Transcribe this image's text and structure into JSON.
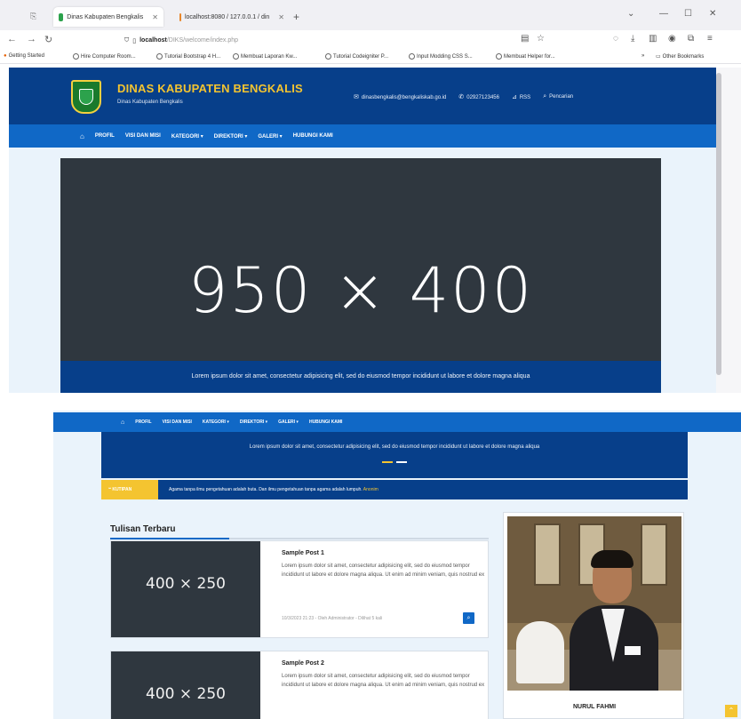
{
  "browser": {
    "tabs": [
      {
        "label": "Dinas Kabupaten Bengkalis",
        "active": true
      },
      {
        "label": "localhost:8080 / 127.0.0.1 / din",
        "active": false
      }
    ],
    "new_tab": "+",
    "url": "localhost",
    "url_path": "/DIKS/welcome/index.php",
    "bookmarks": [
      "Getting Started",
      "Hire Computer Room...",
      "Tutorial Bootstrap 4 H...",
      "Membuat Laporan Kw...",
      "Tutorial Codeigniter P...",
      "Input Modding CSS S...",
      "Membuat Helper for..."
    ],
    "other_bookmarks": "Other Bookmarks"
  },
  "site": {
    "title": "DINAS KABUPATEN BENGKALIS",
    "subtitle": "Dinas Kabupaten Bengkalis",
    "email": "dinasbengkalis@bengkaliskab.go.id",
    "phone": "02927123456",
    "rss": "RSS",
    "search": "Pencarian",
    "menu": [
      "PROFIL",
      "VISI DAN MISI",
      "KATEGORI ▾",
      "DIREKTORI ▾",
      "GALERI ▾",
      "HUBUNGI KAMI"
    ],
    "slider_label": "950 × 400",
    "caption": "Lorem ipsum dolor sit amet, consectetur adipisicing elit, sed do eiusmod tempor incididunt ut labore et dolore magna aliqua"
  },
  "news": {
    "badge": "KUTIPAN",
    "text": "Agama tanpa ilmu pengetahuan adalah buta. Dan ilmu pengetahuan tanpa agama adalah lumpuh.",
    "author": "Anonim"
  },
  "latest": {
    "title": "Tulisan Terbaru",
    "posts": [
      {
        "thumb": "400 × 250",
        "title": "Sample Post 1",
        "body": "Lorem ipsum dolor sit amet, consectetur adipisicing elit, sed do eiusmod tempor incididunt ut labore et dolore magna aliqua. Ut enim ad minim veniam, quis nostrud ex",
        "meta": "10/3/2023 21:23 - Oleh Administrator - Dilihat 5 kali"
      },
      {
        "thumb": "400 × 250",
        "title": "Sample Post 2",
        "body": "Lorem ipsum dolor sit amet, consectetur adipisicing elit, sed do eiusmod tempor incididunt ut labore et dolore magna aliqua. Ut enim ad minim veniam, quis nostrud ex",
        "meta": ""
      }
    ]
  },
  "profile": {
    "name": "NURUL FAHMI"
  },
  "colors": {
    "header_blue": "#073f8a",
    "menu_blue": "#1068c6",
    "accent_yellow": "#f4c430",
    "placeholder_dark": "#2f373f"
  }
}
